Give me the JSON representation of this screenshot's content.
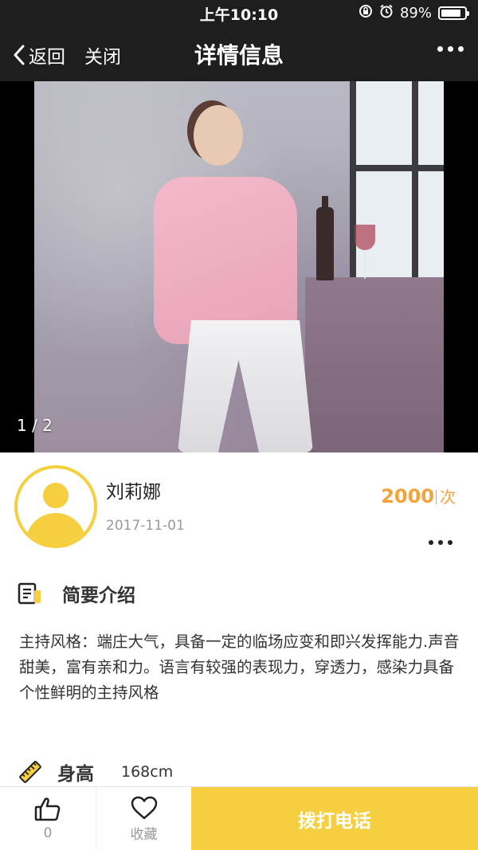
{
  "status_bar": {
    "time": "上午10:10",
    "battery": "89%",
    "battery_level": 0.89,
    "icons": [
      "rotation-lock-icon",
      "alarm-icon",
      "battery-icon"
    ]
  },
  "nav": {
    "back_label": "返回",
    "close_label": "关闭",
    "title": "详情信息",
    "more_icon": "more-icon"
  },
  "gallery": {
    "counter": "1 / 2"
  },
  "profile": {
    "name": "刘莉娜",
    "date": "2017-11-01",
    "price": "2000",
    "price_unit": "次"
  },
  "intro": {
    "title": "简要介绍",
    "text": "主持风格：端庄大气，具备一定的临场应变和即兴发挥能力.声音甜美，富有亲和力。语言有较强的表现力，穿透力，感染力具备个性鲜明的主持风格"
  },
  "details": {
    "height_label": "身高",
    "height_value": "168cm"
  },
  "bottom_bar": {
    "like_count": "0",
    "favorite_label": "收藏",
    "call_label": "拨打电话"
  },
  "colors": {
    "accent": "#f5cf3f",
    "price": "#f3a33a",
    "header_bg": "#1e1e1e"
  }
}
